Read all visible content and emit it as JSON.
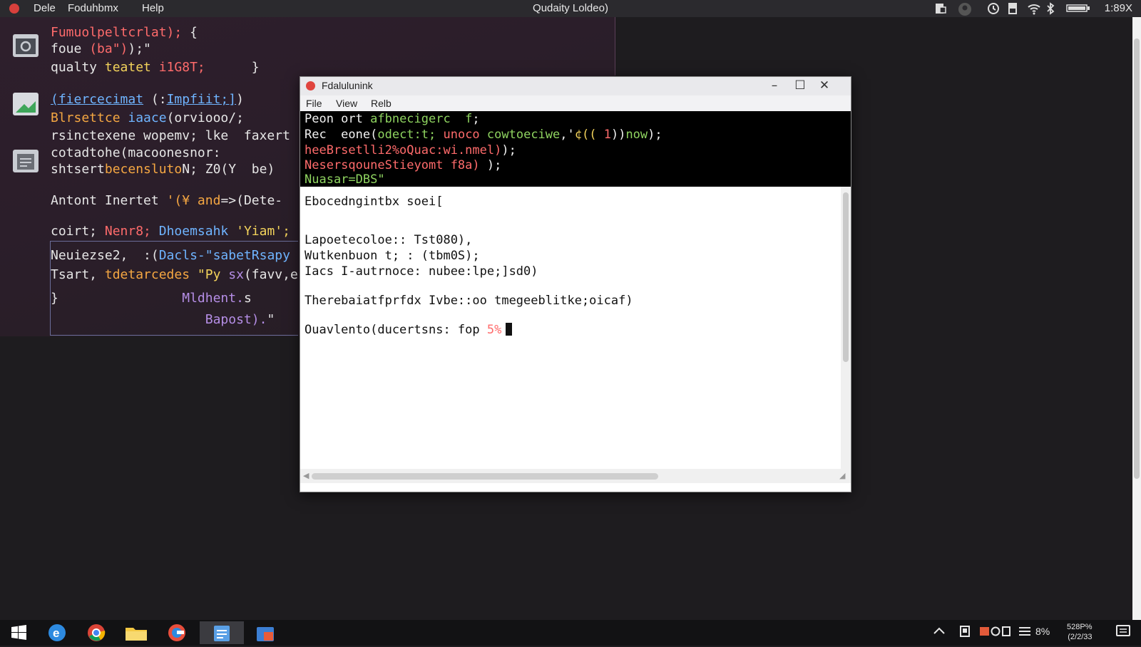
{
  "menubar": {
    "items": [
      "Dele",
      "Foduhbmx",
      "Help"
    ],
    "title": "Qudaity Loldeo)",
    "clock": "1:89X"
  },
  "editor": {
    "lines": [
      {
        "a": "Fumuolpeltcrlat);",
        "b": " {"
      },
      {
        "a": "foue ",
        "b": "(ba\")",
        "c": ");\""
      },
      {
        "a": "qualty ",
        "b": "teatet ",
        "c": "i1G8T;",
        "d": "      }"
      },
      {
        "a": "(fiercecimat",
        "b": " (:",
        "c": "Impfiit;]",
        "d": ")"
      },
      {
        "a": "Blrsettce ",
        "b": "iaace",
        "c": "(orviooo/;"
      },
      {
        "a": "rsinctexene wopemv; lke  faxert"
      },
      {
        "a": "cotadtohe(macoonesnor:"
      },
      {
        "a": "shtsert",
        "b": "becensluto",
        "c": "N;",
        "d": " Z0(Y  be)"
      },
      {
        "a": "Antont Inertet ",
        "b": "'(¥",
        "c": " and",
        "d": "=>(Dete-"
      },
      {
        "a": "coirt; ",
        "b": "Nenr8;",
        "c": " Dhoemsahk",
        "d": " 'Yiam';"
      },
      {
        "a": "Neuiezse2,  :(",
        "b": "Dacls-\"sabet",
        "c": "Rsapy"
      },
      {
        "a": "Tsart, ",
        "b": "tdetarcedes",
        "c": " \"Py ",
        "d": "sx",
        "e": "(favv,e"
      },
      {
        "a": "}",
        "b": "                Mldhent.",
        "c": "s"
      },
      {
        "a": "                    Bapost).",
        "b": "\""
      }
    ]
  },
  "terminal": {
    "title": "Fdalulunink",
    "menu": [
      "File",
      "View",
      "Relb"
    ],
    "dark_lines": [
      {
        "a": "Peon ort ",
        "b": "afbnecigerc  f",
        "c": ";"
      },
      {
        "a": "Rec  eone(",
        "b": "odect:t; ",
        "c": "unoco",
        "d": " cowtoeciwe",
        "e": ",'",
        "f": "¢((",
        "g": " 1",
        "h": "))",
        "i": "now",
        "j": ");"
      },
      {
        "a": "heeBrsetlli2%oQuac:",
        "b": "wi.nmel)",
        "c": ");"
      },
      {
        "a": "NesersqouneStieyomt f8a)",
        "b": " );"
      },
      {
        "a": "Nuasar=DBS\""
      }
    ],
    "light_lines": [
      "Ebocedngintbx soei[",
      "Lapoetecoloe:: Tst080),",
      "Wutkenbuon t; : (tbm0S);",
      "Iacs I-autrnoce: nubee:lpe;]sd0)",
      "Therebaiatfprfdx Ivbe::oo tmegeeblitke;oicaf)"
    ],
    "prompt": {
      "text": "Ouavlento(ducertsns: fop ",
      "pct": "5%"
    },
    "window_controls": {
      "minimize": "–",
      "maximize": "☐",
      "close": "✕"
    }
  },
  "taskbar": {
    "tray": "8%",
    "time": "528P%",
    "date": "(2/2/33"
  },
  "colors": {
    "accent_red": "#ff6b6b",
    "accent_green": "#8fd460",
    "accent_blue": "#6fb4ff",
    "bg_dark": "#1e1c1f"
  }
}
